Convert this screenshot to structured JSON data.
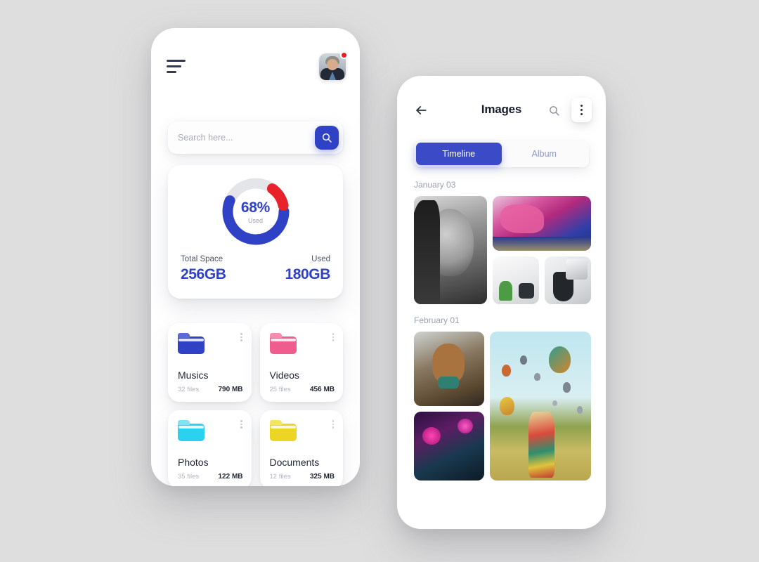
{
  "app": {
    "background_color": "#dedede",
    "accent_blue": "#2f41c4",
    "accent_red": "#e8222a"
  },
  "storage_screen": {
    "name": "storage-dashboard",
    "menu_icon": "hamburger-icon",
    "avatar": {
      "name": "user-avatar",
      "has_notification": true,
      "notification_color": "#e8222a"
    },
    "search": {
      "placeholder": "Search here...",
      "value": "",
      "button_icon": "search-icon",
      "button_color": "#2f41c4"
    },
    "storage_card": {
      "percent_text": "68%",
      "percent_sub": "Used",
      "total_space_label": "Total Space",
      "total_space_value": "256GB",
      "used_label": "Used",
      "used_value": "180GB"
    },
    "folders": [
      {
        "name": "Musics",
        "files": "32 files",
        "size": "790 MB",
        "color": "#2f41c4",
        "tab_color": "#5b6ad8",
        "icon": "folder-icon"
      },
      {
        "name": "Videos",
        "files": "25 files",
        "size": "456 MB",
        "color": "#ef5d8e",
        "tab_color": "#f88cb0",
        "icon": "folder-icon"
      },
      {
        "name": "Photos",
        "files": "35 files",
        "size": "122 MB",
        "color": "#2ad2f0",
        "tab_color": "#7ce4f7",
        "icon": "folder-icon"
      },
      {
        "name": "Documents",
        "files": "12 files",
        "size": "325 MB",
        "color": "#ecd623",
        "tab_color": "#f4e45e",
        "icon": "folder-icon"
      }
    ]
  },
  "gallery_screen": {
    "name": "images-gallery",
    "back_icon": "arrow-left-icon",
    "title": "Images",
    "search_icon": "search-icon",
    "overflow_icon": "more-vertical-icon",
    "tabs": [
      {
        "label": "Timeline",
        "active": true
      },
      {
        "label": "Album",
        "active": false
      }
    ],
    "active_tab_color": "#3b4bc8",
    "sections": [
      {
        "date": "January 03",
        "photos": [
          {
            "alt": "black-and-white-portrait",
            "art": "art-portrait"
          },
          {
            "alt": "graffiti-wall",
            "art": "art-graffiti"
          },
          {
            "alt": "desk-with-plant-and-camera",
            "art": "art-desk"
          },
          {
            "alt": "coffee-mug-and-laptop",
            "art": "art-mug"
          }
        ]
      },
      {
        "date": "February 01",
        "photos": [
          {
            "alt": "dog-in-car",
            "art": "art-dog"
          },
          {
            "alt": "neon-lanterns",
            "art": "art-neon"
          },
          {
            "alt": "woman-watching-hot-air-balloons",
            "art": "art-balloons"
          }
        ]
      }
    ]
  },
  "chart_data": {
    "type": "pie",
    "title": "Storage Usage",
    "categories": [
      "Used (blue)",
      "Used (red)",
      "Free"
    ],
    "values": [
      56,
      12,
      32
    ],
    "center_label": "68%",
    "center_sublabel": "Used",
    "colors": [
      "#2f41c4",
      "#e8222a",
      "#e4e5e9"
    ],
    "total_space_gb": 256,
    "used_gb": 180,
    "used_percent": 68,
    "legend": [
      {
        "name": "Total Space",
        "value": "256GB"
      },
      {
        "name": "Used",
        "value": "180GB"
      }
    ]
  }
}
